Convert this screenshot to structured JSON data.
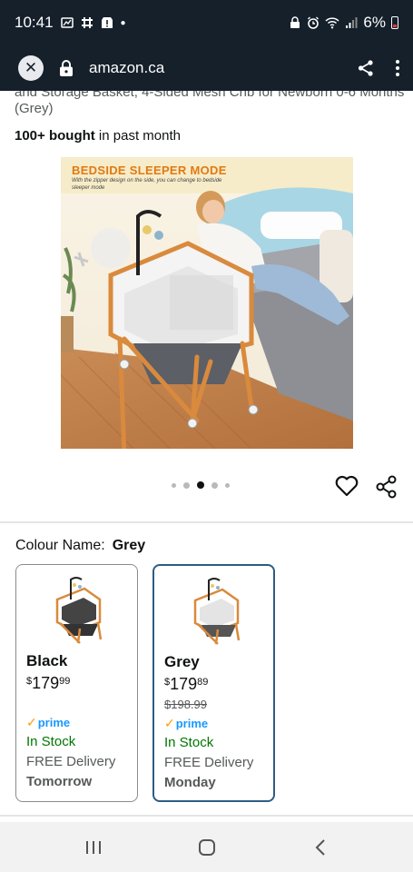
{
  "status": {
    "time": "10:41",
    "battery": "6%"
  },
  "browser": {
    "url": "amazon.ca"
  },
  "product": {
    "title_fragment": "and Storage Basket, 4-Sided Mesh Crib for Newborn 0-6 Months (Grey)",
    "bought_bold": "100+ bought",
    "bought_rest": " in past month",
    "image_banner": "BEDSIDE SLEEPER MODE",
    "image_caption": "With the zipper design on the side, you can change to bedside sleeper mode",
    "carousel": {
      "count": 5,
      "active_index": 2
    }
  },
  "colour": {
    "label": "Colour Name:",
    "selected": "Grey",
    "options": [
      {
        "name": "Black",
        "currency": "$",
        "price_whole": "179",
        "price_cents": "99",
        "list_price": "",
        "prime": "prime",
        "stock": "In Stock",
        "delivery": "FREE Delivery",
        "delivery_day": "Tomorrow",
        "selected": false
      },
      {
        "name": "Grey",
        "currency": "$",
        "price_whole": "179",
        "price_cents": "89",
        "list_price": "$198.99",
        "prime": "prime",
        "stock": "In Stock",
        "delivery": "FREE Delivery",
        "delivery_day": "Monday",
        "selected": true
      }
    ]
  },
  "colors": {
    "status_bar": "#15202b",
    "accent_selected": "#2d5c85",
    "prime_blue": "#1a98ff",
    "prime_check": "#ff9900",
    "in_stock": "#007600"
  },
  "icons": [
    "close-icon",
    "lock-icon",
    "share-icon",
    "more-icon",
    "heart-icon",
    "recents-icon",
    "home-icon",
    "back-icon"
  ]
}
